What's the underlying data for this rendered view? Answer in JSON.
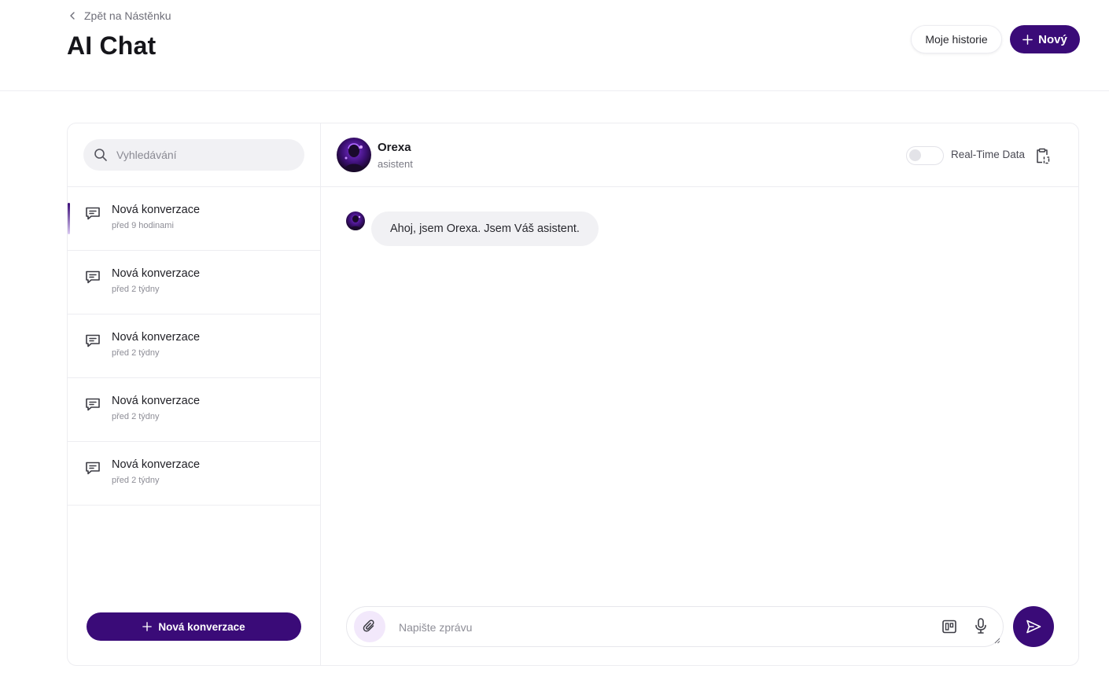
{
  "header": {
    "back_label": "Zpět na Nástěnku",
    "title": "AI Chat",
    "history_button": "Moje historie",
    "new_button": "Nový"
  },
  "sidebar": {
    "search_placeholder": "Vyhledávání",
    "conversations": [
      {
        "title": "Nová konverzace",
        "time": "před 9 hodinami",
        "active": true
      },
      {
        "title": "Nová konverzace",
        "time": "před 2 týdny",
        "active": false
      },
      {
        "title": "Nová konverzace",
        "time": "před 2 týdny",
        "active": false
      },
      {
        "title": "Nová konverzace",
        "time": "před 2 týdny",
        "active": false
      },
      {
        "title": "Nová konverzace",
        "time": "před 2 týdny",
        "active": false
      }
    ],
    "new_conversation_button": "Nová konverzace"
  },
  "chat": {
    "assistant_name": "Orexa",
    "assistant_role": "asistent",
    "realtime_label": "Real-Time Data",
    "realtime_enabled": false,
    "messages": [
      {
        "from": "assistant",
        "text": "Ahoj, jsem Orexa. Jsem Váš asistent."
      }
    ],
    "input_placeholder": "Napište zprávu"
  },
  "colors": {
    "accent": "#3a0b78",
    "attach_bg": "#f2e8fb",
    "bubble_bg": "#f1f1f4"
  }
}
